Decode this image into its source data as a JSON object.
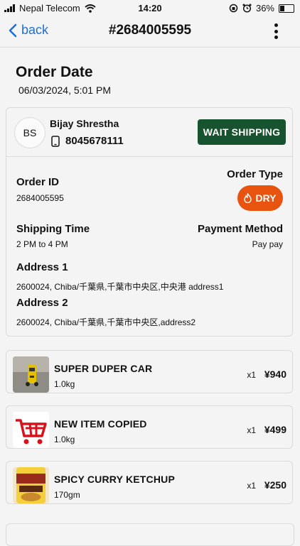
{
  "status_bar": {
    "carrier": "Nepal Telecom",
    "time": "14:20",
    "battery": "36%",
    "battery_level": 0.36
  },
  "header": {
    "back_label": "back",
    "title": "#2684005595"
  },
  "order_date": {
    "label": "Order Date",
    "value": "06/03/2024, 5:01 PM"
  },
  "customer": {
    "initials": "BS",
    "name": "Bijay Shrestha",
    "phone": "8045678111"
  },
  "status_button": {
    "label": "WAIT SHIPPING",
    "color": "#17532e"
  },
  "details": {
    "order_id_label": "Order ID",
    "order_id": "2684005595",
    "order_type_label": "Order Type",
    "order_type": "DRY",
    "order_type_color": "#e8540f",
    "shipping_time_label": "Shipping Time",
    "shipping_time": "2 PM to 4 PM",
    "payment_method_label": "Payment Method",
    "payment_method": "Pay pay",
    "address1_label": "Address 1",
    "address1": "2600024, Chiba/千葉県,千葉市中央区,中央港 address1",
    "address2_label": "Address 2",
    "address2": "2600024, Chiba/千葉県,千葉市中央区,address2"
  },
  "items": [
    {
      "name": "SUPER DUPER CAR",
      "weight": "1.0kg",
      "qty": "x1",
      "price": "¥940",
      "thumb": "yellow-car-photo"
    },
    {
      "name": "NEW ITEM COPIED",
      "weight": "1.0kg",
      "qty": "x1",
      "price": "¥499",
      "thumb": "red-cart-icon"
    },
    {
      "name": "SPICY CURRY KETCHUP",
      "weight": "170gm",
      "qty": "x1",
      "price": "¥250",
      "thumb": "ketchup-bottle-photo"
    }
  ]
}
